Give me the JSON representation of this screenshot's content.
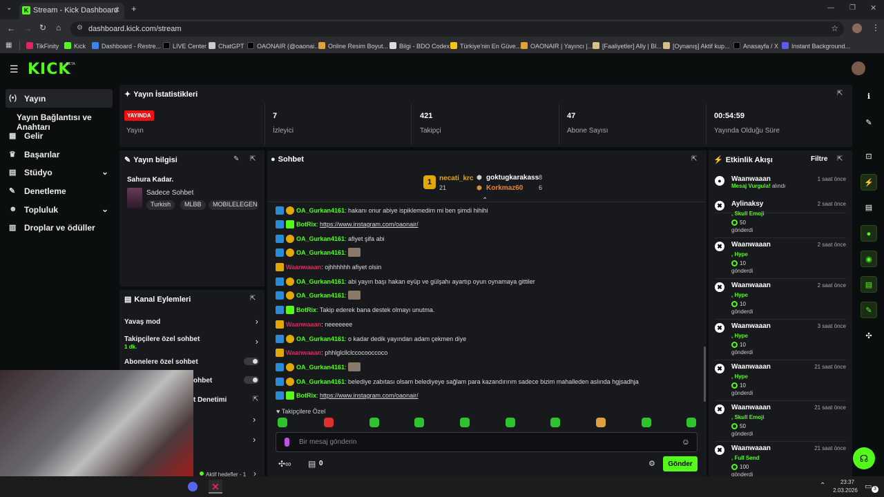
{
  "browser": {
    "tab_title": "Stream - Kick Dashboard",
    "url": "dashboard.kick.com/stream",
    "bookmarks": [
      {
        "label": "TikFinity",
        "color": "#e0245e"
      },
      {
        "label": "Kick",
        "color": "#53fc18"
      },
      {
        "label": "Dashboard - Restre...",
        "color": "#3b82f6"
      },
      {
        "label": "LIVE Center",
        "color": "#000000"
      },
      {
        "label": "ChatGPT",
        "color": "#cccccc"
      },
      {
        "label": "OAONAIR (@oaonai...",
        "color": "#000000"
      },
      {
        "label": "Online Resim Boyut...",
        "color": "#e2a23a"
      },
      {
        "label": "Bilgi - BDO Codex",
        "color": "#dddddd"
      },
      {
        "label": "Türkiye'nin En Güve...",
        "color": "#f5c518"
      },
      {
        "label": "OAONAIR | Yayıncı |...",
        "color": "#e2a23a"
      },
      {
        "label": "[Faaliyetler] Ally | Bl...",
        "color": "#d9c08a"
      },
      {
        "label": "[Oynanış] Aktif kup...",
        "color": "#d9c08a"
      },
      {
        "label": "Anasayfa / X",
        "color": "#000000"
      },
      {
        "label": "Instant Background...",
        "color": "#5b5bf0"
      }
    ]
  },
  "app": {
    "logo": "KICK",
    "beta": "BETA"
  },
  "sidebar": {
    "items": [
      {
        "label": "Yayın",
        "icon": "(•)"
      },
      {
        "label": "Yayın Bağlantısı ve Anahtarı",
        "icon": ""
      },
      {
        "label": "Gelir",
        "icon": "▦"
      },
      {
        "label": "Başarılar",
        "icon": "♛"
      },
      {
        "label": "Stüdyo",
        "icon": "▤"
      },
      {
        "label": "Denetleme",
        "icon": "✎"
      },
      {
        "label": "Topluluk",
        "icon": "☻"
      },
      {
        "label": "Droplar ve ödüller",
        "icon": "▥"
      }
    ]
  },
  "stats": {
    "title": "Yayın İstatistikleri",
    "live_badge": "YAYINDA",
    "live_label": "Yayın",
    "viewers_value": "7",
    "viewers_label": "İzleyici",
    "followers_value": "421",
    "followers_label": "Takipçi",
    "subs_value": "47",
    "subs_label": "Abone Sayısı",
    "uptime_value": "00:54:59",
    "uptime_label": "Yayında Olduğu Süre"
  },
  "stream_info": {
    "title": "Yayın bilgisi",
    "stream_title": "Sahura Kadar.",
    "category": "Sadece Sohbet",
    "tags": [
      "Turkish",
      "MLBB",
      "MOBILELEGEN"
    ]
  },
  "channel_actions": {
    "title": "Kanal Eylemleri",
    "slow_mode": "Yavaş mod",
    "followers_chat": "Takipçilere özel sohbet",
    "followers_chat_sub": "1 dk.",
    "subs_chat": "Abonelere özel sohbet",
    "emote_chat": "ohbet",
    "moderation": "t Denetimi",
    "active_goals": "Aktif hedefler - 1"
  },
  "chat": {
    "title": "Sohbet",
    "leaderboard": [
      {
        "rank": "1",
        "name": "necati_krc",
        "count": "21"
      },
      {
        "name": "goktugkarakass",
        "count": "8"
      },
      {
        "name": "Korkmaz60",
        "count": "6"
      }
    ],
    "messages": [
      {
        "user": "OA_Gurkan4161",
        "text": ": hakanı onur abiye ispiklemedim mi ben şimdi hihihi",
        "color": "#53fc18",
        "badges": [
          "#2b8bd6",
          "#e0a800"
        ]
      },
      {
        "user": "BotRix",
        "text": "https://www.instagram.com/oaonair/",
        "color": "#53fc18",
        "badges": [
          "#2b8bd6",
          "#53fc18"
        ],
        "link": true
      },
      {
        "user": "OA_Gurkan4161",
        "text": ": afiyet şifa abi",
        "color": "#53fc18",
        "badges": [
          "#2b8bd6",
          "#e0a800"
        ]
      },
      {
        "user": "OA_Gurkan4161",
        "text": ":",
        "color": "#53fc18",
        "badges": [
          "#2b8bd6",
          "#e0a800"
        ],
        "emote": true
      },
      {
        "user": "Waanwaaan",
        "text": ": ojhhhhhh afiyet olsin",
        "color": "#e0245e",
        "badges": [
          "#e0a800"
        ]
      },
      {
        "user": "OA_Gurkan4161",
        "text": ": abi yayın başı hakan eyüp ve gülşahı ayartıp oyun oynamaya gittiler",
        "color": "#53fc18",
        "badges": [
          "#2b8bd6",
          "#e0a800"
        ]
      },
      {
        "user": "OA_Gurkan4161",
        "text": ":",
        "color": "#53fc18",
        "badges": [
          "#2b8bd6",
          "#e0a800"
        ],
        "emote": true
      },
      {
        "user": "BotRix",
        "text": ": Takip ederek bana destek olmayı unutma.",
        "color": "#53fc18",
        "badges": [
          "#2b8bd6",
          "#53fc18"
        ]
      },
      {
        "user": "Waanwaaan",
        "text": ": neeeeeee",
        "color": "#e0245e",
        "badges": [
          "#e0a800"
        ]
      },
      {
        "user": "OA_Gurkan4161",
        "text": ":    o kadar dedik yayından adam çekmen diye",
        "color": "#53fc18",
        "badges": [
          "#2b8bd6",
          "#e0a800"
        ]
      },
      {
        "user": "Waanwaaan",
        "text": ": phhlglcllclccocooccoco",
        "color": "#e0245e",
        "badges": [
          "#e0a800"
        ]
      },
      {
        "user": "OA_Gurkan4161",
        "text": ":",
        "color": "#53fc18",
        "badges": [
          "#2b8bd6",
          "#e0a800"
        ],
        "emote": true
      },
      {
        "user": "OA_Gurkan4161",
        "text": ": belediye zabıtası olsam belediyeye sağlam para kazandırırım sadece bizim mahalleden aslında hgjsadhja",
        "color": "#53fc18",
        "badges": [
          "#2b8bd6",
          "#e0a800"
        ]
      },
      {
        "user": "BotRix",
        "text": "https://www.instagram.com/oaonair/",
        "color": "#53fc18",
        "badges": [
          "#2b8bd6",
          "#53fc18"
        ],
        "link": true
      }
    ],
    "followers_only_label": "Takipçilere Özel",
    "input_placeholder": "Bir mesaj gönderin",
    "points_value": "0",
    "send_label": "Gönder"
  },
  "events": {
    "title": "Etkinlik Akışı",
    "filter": "Filtre",
    "items": [
      {
        "name": "Waanwaaan",
        "time": "1 saat önce",
        "action": "Mesaj Vurgula!",
        "suffix": " alındı"
      },
      {
        "name": "Aylinaksy",
        "time": "2 saat önce",
        "action": ", Skull Emoji",
        "count": "50",
        "sent": "gönderdi"
      },
      {
        "name": "Waanwaaan",
        "time": "2 saat önce",
        "action": ", Hype",
        "count": "10",
        "sent": "gönderdi"
      },
      {
        "name": "Waanwaaan",
        "time": "2 saat önce",
        "action": ", Hype",
        "count": "10",
        "sent": "gönderdi"
      },
      {
        "name": "Waanwaaan",
        "time": "3 saat önce",
        "action": ", Hype",
        "count": "10",
        "sent": "gönderdi"
      },
      {
        "name": "Waanwaaan",
        "time": "21 saat önce",
        "action": ", Hype",
        "count": "10",
        "sent": "gönderdi"
      },
      {
        "name": "Waanwaaan",
        "time": "21 saat önce",
        "action": ", Skull Emoji",
        "count": "50",
        "sent": "gönderdi"
      },
      {
        "name": "Waanwaaan",
        "time": "21 saat önce",
        "action": ", Full Send",
        "count": "100",
        "sent": "gönderdi"
      }
    ]
  },
  "taskbar": {
    "time": "23:37",
    "date": "2.03.2026",
    "notif_count": "3"
  },
  "colors": {
    "accent": "#53fc18",
    "live": "#ee1111",
    "panel": "#18191c"
  }
}
